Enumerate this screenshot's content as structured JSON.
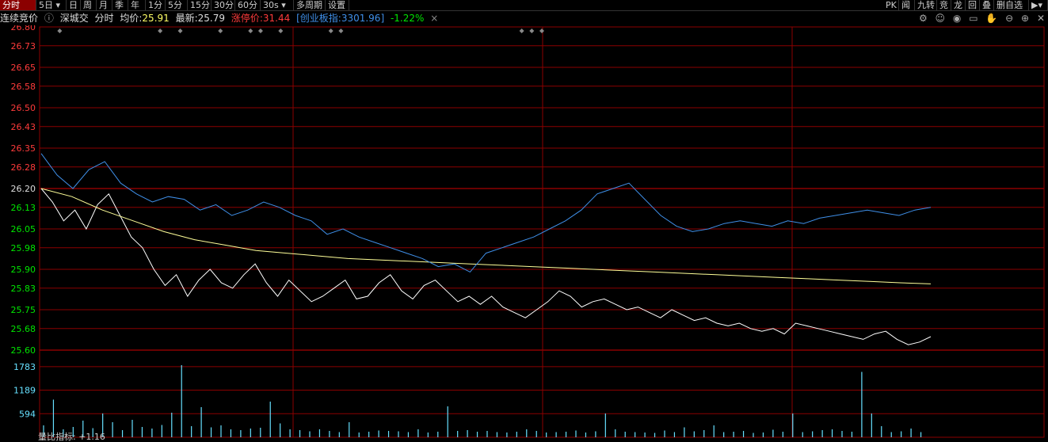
{
  "toolbar": {
    "tabs": [
      "分时",
      "5日",
      "日",
      "周",
      "月",
      "季",
      "年",
      "1分",
      "5分",
      "15分",
      "30分",
      "60分",
      "30s",
      "多周期",
      "设置"
    ],
    "right_tabs": [
      "PK",
      "闻",
      "九转",
      "竞",
      "龙",
      "回",
      "叠",
      "删自选"
    ]
  },
  "infobar": {
    "auction": "连续竞价",
    "name": "深城交",
    "mode": "分时",
    "avg_label": "均价:",
    "avg_value": "25.91",
    "latest_label": "最新:",
    "latest_value": "25.79",
    "limit_label": "涨停价:",
    "limit_value": "31.44",
    "index_label": "创业板指:",
    "index_value": "3301.96",
    "index_change": "-1.22%",
    "close_glyph": "×"
  },
  "footer_label": "量比指标: +1.16",
  "colors": {
    "up": "#ff3b3b",
    "down": "#00e600",
    "grid": "#8b0000",
    "price": "#ffffff",
    "avg": "#ffff99",
    "index": "#3f8fe8",
    "volume": "#66e0ff"
  },
  "chart_data": {
    "type": "line",
    "price_axis_ticks": [
      "26.80",
      "26.73",
      "26.65",
      "26.58",
      "26.50",
      "26.43",
      "26.35",
      "26.28",
      "26.20",
      "26.13",
      "26.05",
      "25.98",
      "25.90",
      "25.83",
      "25.75",
      "25.68",
      "25.60"
    ],
    "volume_axis_ticks": [
      "1783",
      "1189",
      "594"
    ],
    "ylim": [
      25.6,
      26.8
    ],
    "prev_close": 26.2,
    "series": [
      {
        "name": "price",
        "values": [
          26.2,
          26.15,
          26.08,
          26.12,
          26.05,
          26.14,
          26.18,
          26.1,
          26.02,
          25.98,
          25.9,
          25.84,
          25.88,
          25.8,
          25.86,
          25.9,
          25.85,
          25.83,
          25.88,
          25.92,
          25.85,
          25.8,
          25.86,
          25.82,
          25.78,
          25.8,
          25.83,
          25.86,
          25.79,
          25.8,
          25.85,
          25.88,
          25.82,
          25.79,
          25.84,
          25.86,
          25.82,
          25.78,
          25.8,
          25.77,
          25.8,
          25.76,
          25.74,
          25.72,
          25.75,
          25.78,
          25.82,
          25.8,
          25.76,
          25.78,
          25.79,
          25.77,
          25.75,
          25.76,
          25.74,
          25.72,
          25.75,
          25.73,
          25.71,
          25.72,
          25.7,
          25.69,
          25.7,
          25.68,
          25.67,
          25.68,
          25.66,
          25.7,
          25.69,
          25.68,
          25.67,
          25.66,
          25.65,
          25.64,
          25.66,
          25.67,
          25.64,
          25.62,
          25.63,
          25.65
        ]
      },
      {
        "name": "avg",
        "values": [
          26.2,
          26.17,
          26.12,
          26.08,
          26.04,
          26.01,
          25.99,
          25.97,
          25.96,
          25.95,
          25.94,
          25.935,
          25.93,
          25.925,
          25.92,
          25.915,
          25.91,
          25.905,
          25.9,
          25.895,
          25.89,
          25.885,
          25.88,
          25.875,
          25.87,
          25.865,
          25.86,
          25.855,
          25.85,
          25.846
        ]
      },
      {
        "name": "index",
        "values": [
          26.33,
          26.25,
          26.2,
          26.27,
          26.3,
          26.22,
          26.18,
          26.15,
          26.17,
          26.16,
          26.12,
          26.14,
          26.1,
          26.12,
          26.15,
          26.13,
          26.1,
          26.08,
          26.03,
          26.05,
          26.02,
          26.0,
          25.98,
          25.96,
          25.94,
          25.91,
          25.92,
          25.89,
          25.96,
          25.98,
          26.0,
          26.02,
          26.05,
          26.08,
          26.12,
          26.18,
          26.2,
          26.22,
          26.16,
          26.1,
          26.06,
          26.04,
          26.05,
          26.07,
          26.08,
          26.07,
          26.06,
          26.08,
          26.07,
          26.09,
          26.1,
          26.11,
          26.12,
          26.11,
          26.1,
          26.12,
          26.13
        ]
      }
    ],
    "volume_values": [
      300,
      950,
      200,
      260,
      420,
      230,
      600,
      380,
      180,
      440,
      260,
      220,
      310,
      620,
      1820,
      280,
      760,
      250,
      300,
      200,
      180,
      220,
      240,
      900,
      350,
      200,
      180,
      150,
      200,
      160,
      130,
      380,
      120,
      140,
      170,
      160,
      150,
      130,
      200,
      120,
      140,
      780,
      160,
      180,
      140,
      160,
      130,
      120,
      140,
      200,
      160,
      120,
      130,
      140,
      170,
      120,
      150,
      600,
      200,
      140,
      130,
      120,
      110,
      170,
      130,
      250,
      150,
      180,
      300,
      130,
      140,
      160,
      110,
      120,
      190,
      140,
      600,
      130,
      150,
      180,
      200,
      160,
      140,
      1650,
      600,
      280,
      130,
      150,
      220,
      130
    ],
    "event_markers": [
      0.02,
      0.12,
      0.14,
      0.18,
      0.21,
      0.22,
      0.24,
      0.29,
      0.3,
      0.48,
      0.49,
      0.5
    ]
  }
}
